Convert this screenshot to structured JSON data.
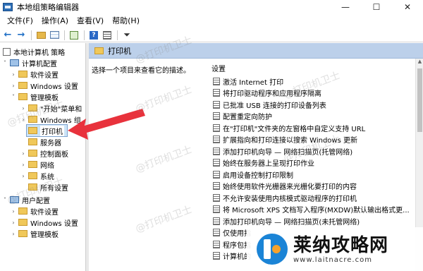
{
  "window": {
    "title": "本地组策略编辑器"
  },
  "window_buttons": {
    "minimize": "—",
    "maximize": "☐",
    "close": "✕"
  },
  "menu": [
    "文件(F)",
    "操作(A)",
    "查看(V)",
    "帮助(H)"
  ],
  "toolbar": {
    "icons": [
      "back-icon",
      "forward-icon",
      "folder-up-icon",
      "show-tree-icon",
      "export-icon",
      "help-icon",
      "properties-icon",
      "filter-icon"
    ]
  },
  "tree": [
    {
      "label": "本地计算机 策略",
      "expander": "",
      "icon": "policy"
    },
    {
      "label": "计算机配置",
      "expander": "˅",
      "icon": "pc"
    },
    {
      "label": "软件设置",
      "expander": "›",
      "icon": "folder"
    },
    {
      "label": "Windows 设置",
      "expander": "›",
      "icon": "folder"
    },
    {
      "label": "管理模板",
      "expander": "˅",
      "icon": "folder"
    },
    {
      "label": "\"开始\"菜单和",
      "expander": "›",
      "icon": "folder"
    },
    {
      "label": "Windows 组",
      "expander": "›",
      "icon": "folder"
    },
    {
      "label": "打印机",
      "expander": "",
      "icon": "folder",
      "selected": true
    },
    {
      "label": "服务器",
      "expander": "",
      "icon": "folder"
    },
    {
      "label": "控制面板",
      "expander": "›",
      "icon": "folder"
    },
    {
      "label": "网络",
      "expander": "›",
      "icon": "folder"
    },
    {
      "label": "系统",
      "expander": "›",
      "icon": "folder"
    },
    {
      "label": "所有设置",
      "expander": "",
      "icon": "folder"
    },
    {
      "label": "用户配置",
      "expander": "˅",
      "icon": "pc"
    },
    {
      "label": "软件设置",
      "expander": "›",
      "icon": "folder"
    },
    {
      "label": "Windows 设置",
      "expander": "›",
      "icon": "folder"
    },
    {
      "label": "管理模板",
      "expander": "›",
      "icon": "folder"
    }
  ],
  "right": {
    "header": "打印机",
    "description": "选择一个项目来查看它的描述。",
    "column_header": "设置",
    "settings": [
      "激活 Internet 打印",
      "将打印驱动程序和应用程序隔离",
      "已批准 USB 连接的打印设备列表",
      "配置重定向防护",
      "在\"打印机\"文件夹的左窗格中自定义支持 URL",
      "扩展指向和打印连接以搜索 Windows 更新",
      "添加打印机向导 — 网络扫描页(托管网络)",
      "始终在服务器上呈现打印作业",
      "启用设备控制打印限制",
      "始终使用软件光栅器来光栅化要打印的内容",
      "不允许安装使用内核模式驱动程序的打印机",
      "将 Microsoft XPS 文档写入程序(MXDW)默认输出格式更...",
      "添加打印机向导 — 网络扫描页(未托管网络)",
      "仅使用指",
      "程序包指",
      "计算机的"
    ]
  },
  "watermark": "@打印机卫士",
  "logo": {
    "title": "莱纳攻略网",
    "url": "www.laitnacre.com"
  }
}
